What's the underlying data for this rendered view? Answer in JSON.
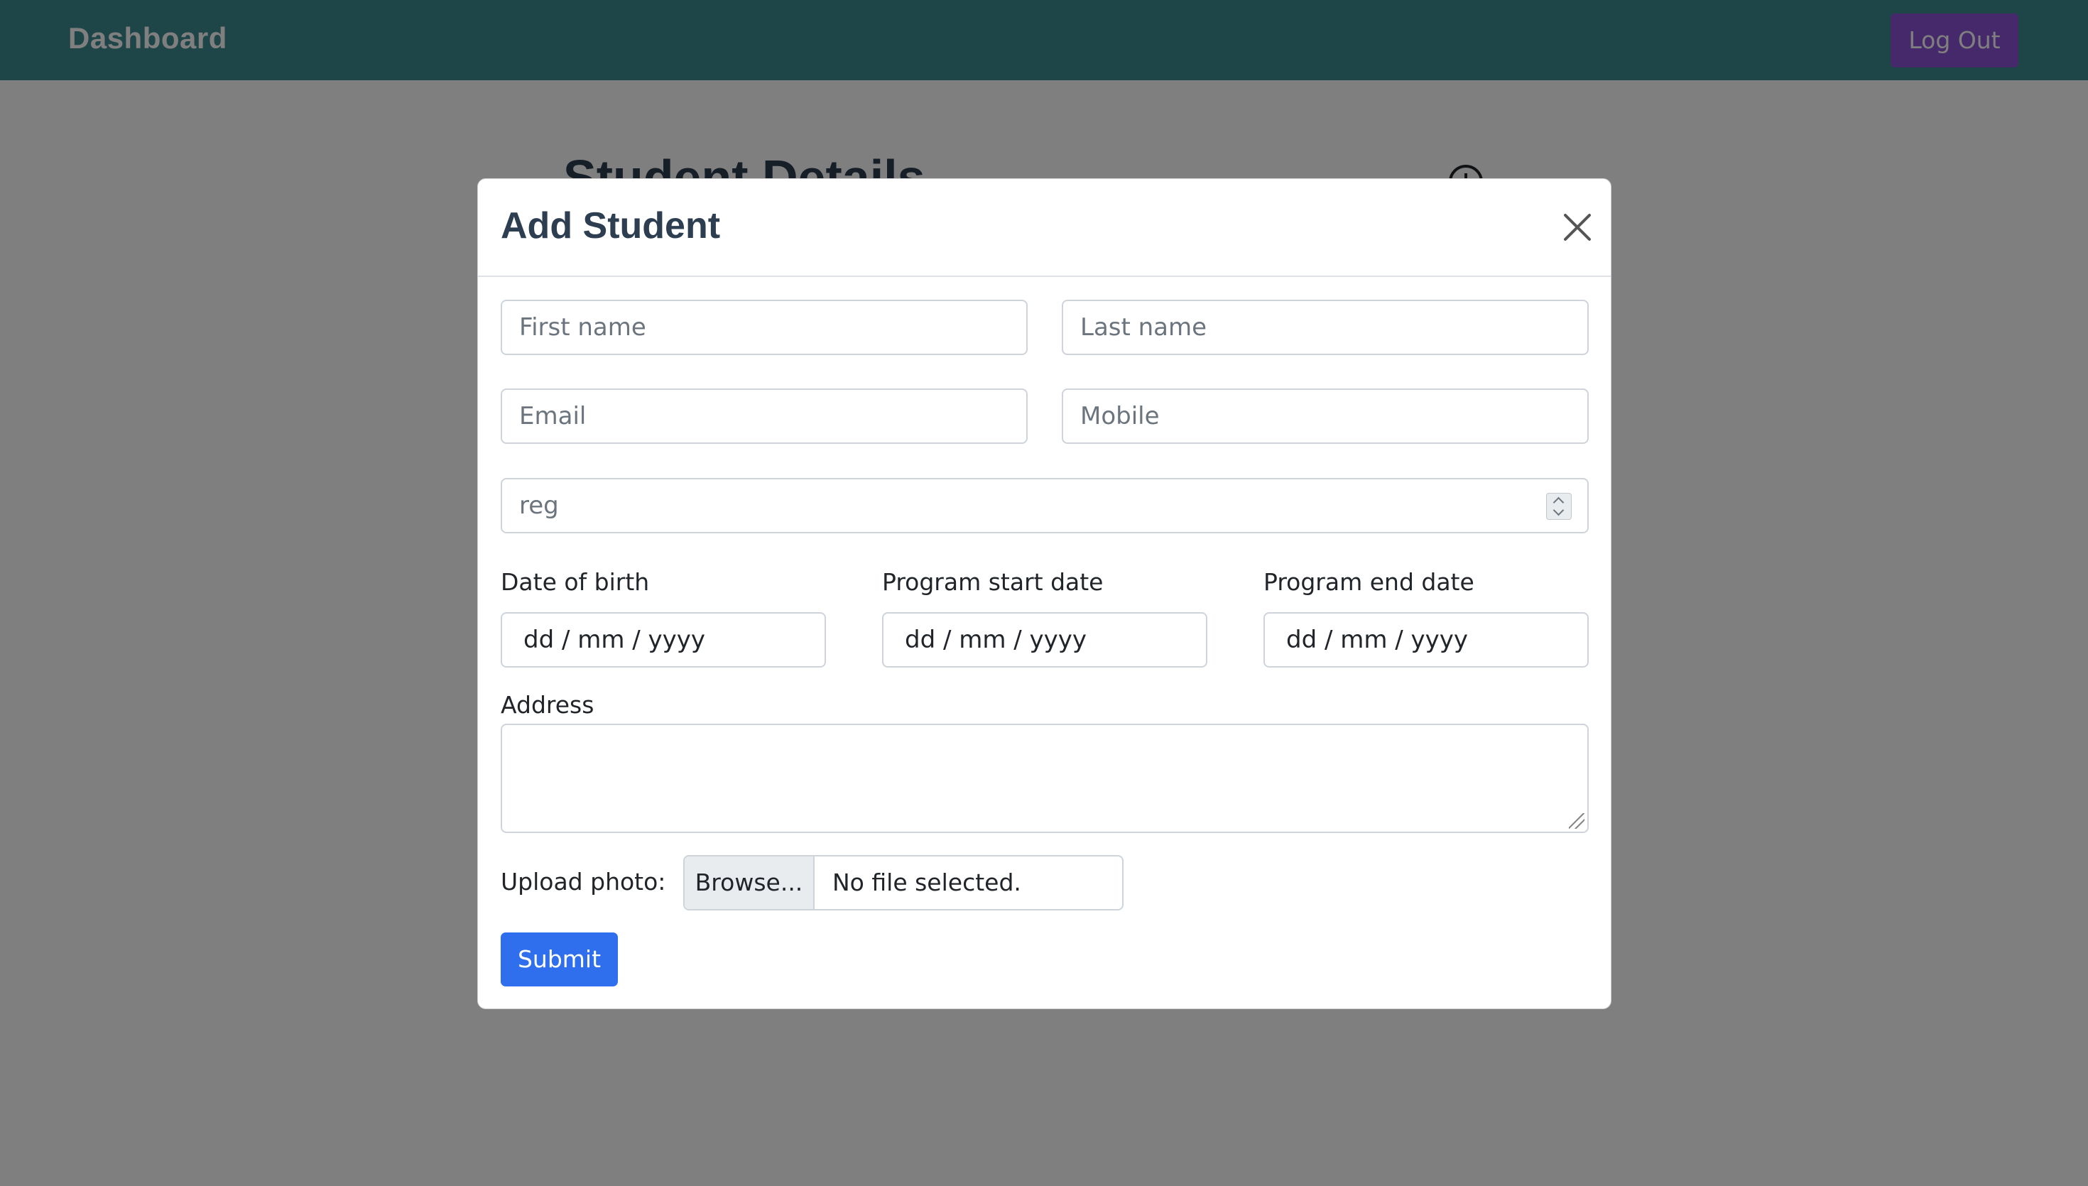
{
  "navbar": {
    "brand": "Dashboard",
    "logout_label": "Log Out"
  },
  "page": {
    "title": "Student Details",
    "add_icon": "plus-circle-icon"
  },
  "modal": {
    "title": "Add Student",
    "close_icon": "close-icon",
    "fields": {
      "first_name_placeholder": "First name",
      "last_name_placeholder": "Last name",
      "email_placeholder": "Email",
      "mobile_placeholder": "Mobile",
      "reg_placeholder": "reg"
    },
    "dates": {
      "dob_label": "Date of birth",
      "start_label": "Program start date",
      "end_label": "Program end date",
      "format": "dd / mm / yyyy"
    },
    "address_label": "Address",
    "upload_label": "Upload photo:",
    "browse_label": "Browse...",
    "file_status": "No file selected.",
    "submit_label": "Submit"
  },
  "colors": {
    "navbar": "#3d8a8e",
    "logout": "#8a52d6",
    "submit": "#2f6fed"
  }
}
